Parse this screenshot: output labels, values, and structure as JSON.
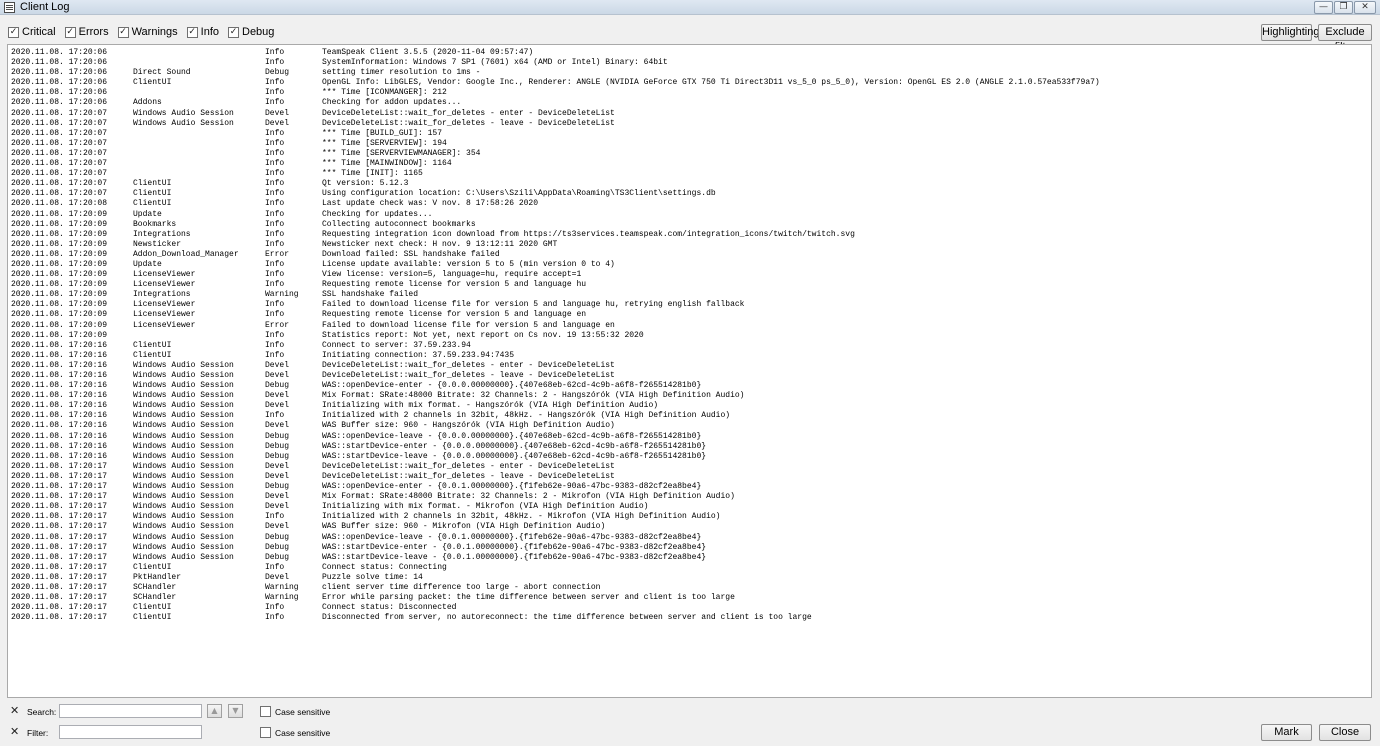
{
  "window": {
    "title": "Client Log",
    "minimize": "—",
    "maximize": "❐",
    "close": "✕"
  },
  "filters": {
    "checkboxes": [
      {
        "label": "Critical",
        "checked": true
      },
      {
        "label": "Errors",
        "checked": true
      },
      {
        "label": "Warnings",
        "checked": true
      },
      {
        "label": "Info",
        "checked": true
      },
      {
        "label": "Debug",
        "checked": true
      }
    ],
    "highlighting_label": "Highlighting",
    "exclude_filter_label": "Exclude filter"
  },
  "log": [
    [
      "2020.11.08. 17:20:06",
      "",
      "Info",
      "TeamSpeak Client 3.5.5 (2020-11-04 09:57:47)"
    ],
    [
      "2020.11.08. 17:20:06",
      "",
      "Info",
      "SystemInformation: Windows 7 SP1 (7601) x64 (AMD or Intel) Binary: 64bit"
    ],
    [
      "2020.11.08. 17:20:06",
      "Direct Sound",
      "Debug",
      "setting timer resolution to 1ms -"
    ],
    [
      "2020.11.08. 17:20:06",
      "ClientUI",
      "Info",
      "OpenGL Info: LibGLES, Vendor: Google Inc., Renderer: ANGLE (NVIDIA GeForce GTX 750 Ti Direct3D11 vs_5_0 ps_5_0), Version: OpenGL ES 2.0 (ANGLE 2.1.0.57ea533f79a7)"
    ],
    [
      "2020.11.08. 17:20:06",
      "",
      "Info",
      "*** Time [ICONMANGER]: 212"
    ],
    [
      "2020.11.08. 17:20:06",
      "Addons",
      "Info",
      "Checking for addon updates..."
    ],
    [
      "2020.11.08. 17:20:07",
      "Windows Audio Session",
      "Devel",
      "DeviceDeleteList::wait_for_deletes - enter - DeviceDeleteList"
    ],
    [
      "2020.11.08. 17:20:07",
      "Windows Audio Session",
      "Devel",
      "DeviceDeleteList::wait_for_deletes - leave - DeviceDeleteList"
    ],
    [
      "2020.11.08. 17:20:07",
      "",
      "Info",
      "*** Time [BUILD_GUI]: 157"
    ],
    [
      "2020.11.08. 17:20:07",
      "",
      "Info",
      "*** Time [SERVERVIEW]: 194"
    ],
    [
      "2020.11.08. 17:20:07",
      "",
      "Info",
      "*** Time [SERVERVIEWMANAGER]: 354"
    ],
    [
      "2020.11.08. 17:20:07",
      "",
      "Info",
      "*** Time [MAINWINDOW]: 1164"
    ],
    [
      "2020.11.08. 17:20:07",
      "",
      "Info",
      "*** Time [INIT]: 1165"
    ],
    [
      "2020.11.08. 17:20:07",
      "ClientUI",
      "Info",
      "Qt version: 5.12.3"
    ],
    [
      "2020.11.08. 17:20:07",
      "ClientUI",
      "Info",
      "Using configuration location: C:\\Users\\Szili\\AppData\\Roaming\\TS3Client\\settings.db"
    ],
    [
      "2020.11.08. 17:20:08",
      "ClientUI",
      "Info",
      "Last update check was: V nov. 8 17:58:26 2020"
    ],
    [
      "2020.11.08. 17:20:09",
      "Update",
      "Info",
      "Checking for updates..."
    ],
    [
      "2020.11.08. 17:20:09",
      "Bookmarks",
      "Info",
      "Collecting autoconnect bookmarks"
    ],
    [
      "2020.11.08. 17:20:09",
      "Integrations",
      "Info",
      "Requesting integration icon download from https://ts3services.teamspeak.com/integration_icons/twitch/twitch.svg"
    ],
    [
      "2020.11.08. 17:20:09",
      "Newsticker",
      "Info",
      "Newsticker next check: H nov. 9 13:12:11 2020 GMT"
    ],
    [
      "2020.11.08. 17:20:09",
      "Addon_Download_Manager",
      "Error",
      "Download failed: SSL handshake failed"
    ],
    [
      "2020.11.08. 17:20:09",
      "Update",
      "Info",
      "License update available: version 5 to 5 (min version 0 to 4)"
    ],
    [
      "2020.11.08. 17:20:09",
      "LicenseViewer",
      "Info",
      "View license: version=5, language=hu, require accept=1"
    ],
    [
      "2020.11.08. 17:20:09",
      "LicenseViewer",
      "Info",
      "Requesting remote license for version 5 and language hu"
    ],
    [
      "2020.11.08. 17:20:09",
      "Integrations",
      "Warning",
      "SSL handshake failed"
    ],
    [
      "2020.11.08. 17:20:09",
      "LicenseViewer",
      "Info",
      "Failed to download license file for version 5 and language hu, retrying english fallback"
    ],
    [
      "2020.11.08. 17:20:09",
      "LicenseViewer",
      "Info",
      "Requesting remote license for version 5 and language en"
    ],
    [
      "2020.11.08. 17:20:09",
      "LicenseViewer",
      "Error",
      "Failed to download license file for version 5 and language en"
    ],
    [
      "2020.11.08. 17:20:09",
      "",
      "Info",
      "Statistics report: Not yet, next report on Cs nov. 19 13:55:32 2020"
    ],
    [
      "2020.11.08. 17:20:16",
      "ClientUI",
      "Info",
      "Connect to server: 37.59.233.94"
    ],
    [
      "2020.11.08. 17:20:16",
      "ClientUI",
      "Info",
      "Initiating connection: 37.59.233.94:7435"
    ],
    [
      "2020.11.08. 17:20:16",
      "Windows Audio Session",
      "Devel",
      "DeviceDeleteList::wait_for_deletes - enter - DeviceDeleteList"
    ],
    [
      "2020.11.08. 17:20:16",
      "Windows Audio Session",
      "Devel",
      "DeviceDeleteList::wait_for_deletes - leave - DeviceDeleteList"
    ],
    [
      "2020.11.08. 17:20:16",
      "Windows Audio Session",
      "Debug",
      "WAS::openDevice-enter - {0.0.0.00000000}.{407e68eb-62cd-4c9b-a6f8-f265514281b0}"
    ],
    [
      "2020.11.08. 17:20:16",
      "Windows Audio Session",
      "Devel",
      "Mix Format: SRate:48000 Bitrate: 32 Channels: 2 - Hangszórók (VIA High Definition Audio)"
    ],
    [
      "2020.11.08. 17:20:16",
      "Windows Audio Session",
      "Devel",
      "Initializing with mix format. - Hangszórók (VIA High Definition Audio)"
    ],
    [
      "2020.11.08. 17:20:16",
      "Windows Audio Session",
      "Info",
      "Initialized with 2 channels in 32bit, 48kHz. - Hangszórók (VIA High Definition Audio)"
    ],
    [
      "2020.11.08. 17:20:16",
      "Windows Audio Session",
      "Devel",
      "WAS Buffer size: 960 - Hangszórók (VIA High Definition Audio)"
    ],
    [
      "2020.11.08. 17:20:16",
      "Windows Audio Session",
      "Debug",
      "WAS::openDevice-leave - {0.0.0.00000000}.{407e68eb-62cd-4c9b-a6f8-f265514281b0}"
    ],
    [
      "2020.11.08. 17:20:16",
      "Windows Audio Session",
      "Debug",
      "WAS::startDevice-enter - {0.0.0.00000000}.{407e68eb-62cd-4c9b-a6f8-f265514281b0}"
    ],
    [
      "2020.11.08. 17:20:16",
      "Windows Audio Session",
      "Debug",
      "WAS::startDevice-leave - {0.0.0.00000000}.{407e68eb-62cd-4c9b-a6f8-f265514281b0}"
    ],
    [
      "2020.11.08. 17:20:17",
      "Windows Audio Session",
      "Devel",
      "DeviceDeleteList::wait_for_deletes - enter - DeviceDeleteList"
    ],
    [
      "2020.11.08. 17:20:17",
      "Windows Audio Session",
      "Devel",
      "DeviceDeleteList::wait_for_deletes - leave - DeviceDeleteList"
    ],
    [
      "2020.11.08. 17:20:17",
      "Windows Audio Session",
      "Debug",
      "WAS::openDevice-enter - {0.0.1.00000000}.{f1feb62e-90a6-47bc-9383-d82cf2ea8be4}"
    ],
    [
      "2020.11.08. 17:20:17",
      "Windows Audio Session",
      "Devel",
      "Mix Format: SRate:48000 Bitrate: 32 Channels: 2 - Mikrofon (VIA High Definition Audio)"
    ],
    [
      "2020.11.08. 17:20:17",
      "Windows Audio Session",
      "Devel",
      "Initializing with mix format. - Mikrofon (VIA High Definition Audio)"
    ],
    [
      "2020.11.08. 17:20:17",
      "Windows Audio Session",
      "Info",
      "Initialized with 2 channels in 32bit, 48kHz. - Mikrofon (VIA High Definition Audio)"
    ],
    [
      "2020.11.08. 17:20:17",
      "Windows Audio Session",
      "Devel",
      "WAS Buffer size: 960 - Mikrofon (VIA High Definition Audio)"
    ],
    [
      "2020.11.08. 17:20:17",
      "Windows Audio Session",
      "Debug",
      "WAS::openDevice-leave - {0.0.1.00000000}.{f1feb62e-90a6-47bc-9383-d82cf2ea8be4}"
    ],
    [
      "2020.11.08. 17:20:17",
      "Windows Audio Session",
      "Debug",
      "WAS::startDevice-enter - {0.0.1.00000000}.{f1feb62e-90a6-47bc-9383-d82cf2ea8be4}"
    ],
    [
      "2020.11.08. 17:20:17",
      "Windows Audio Session",
      "Debug",
      "WAS::startDevice-leave - {0.0.1.00000000}.{f1feb62e-90a6-47bc-9383-d82cf2ea8be4}"
    ],
    [
      "2020.11.08. 17:20:17",
      "ClientUI",
      "Info",
      "Connect status: Connecting"
    ],
    [
      "2020.11.08. 17:20:17",
      "PktHandler",
      "Devel",
      "Puzzle solve time: 14"
    ],
    [
      "2020.11.08. 17:20:17",
      "SCHandler",
      "Warning",
      "client server time difference too large - abort connection"
    ],
    [
      "2020.11.08. 17:20:17",
      "SCHandler",
      "Warning",
      "Error while parsing packet: the time difference between server and client is too large"
    ],
    [
      "2020.11.08. 17:20:17",
      "ClientUI",
      "Info",
      "Connect status: Disconnected"
    ],
    [
      "2020.11.08. 17:20:17",
      "ClientUI",
      "Info",
      "Disconnected from server, no autoreconnect: the time difference between server and client is too large"
    ]
  ],
  "bottom": {
    "search_label": "Search:",
    "search_value": "",
    "filter_label": "Filter:",
    "filter_value": "",
    "case_sensitive_label": "Case sensitive",
    "up_arrow": "▲",
    "down_arrow": "▼",
    "clear_icon": "✕",
    "mark_label": "Mark",
    "close_label": "Close"
  }
}
